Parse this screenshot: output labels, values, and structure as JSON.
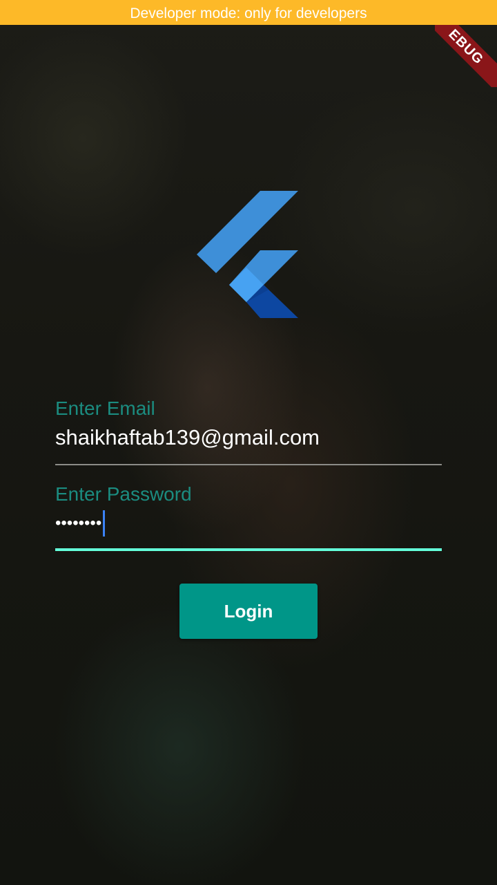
{
  "banner": {
    "text": "Developer mode: only for developers",
    "color": "#fdb928"
  },
  "debug_ribbon": {
    "text": "EBUG",
    "color": "#8a1619"
  },
  "logo": {
    "icon": "flutter-logo-icon",
    "colors": [
      "#3e8fd8",
      "#47a2f2",
      "#0d47a1"
    ]
  },
  "email": {
    "label": "Enter Email",
    "value": "shaikhaftab139@gmail.com"
  },
  "password": {
    "label": "Enter Password",
    "value": "••••••••",
    "focused": true
  },
  "login": {
    "label": "Login"
  },
  "colors": {
    "accent": "#009688",
    "label": "#1b8c80",
    "focus_underline": "#64ffda",
    "caret": "#3b82f6"
  }
}
